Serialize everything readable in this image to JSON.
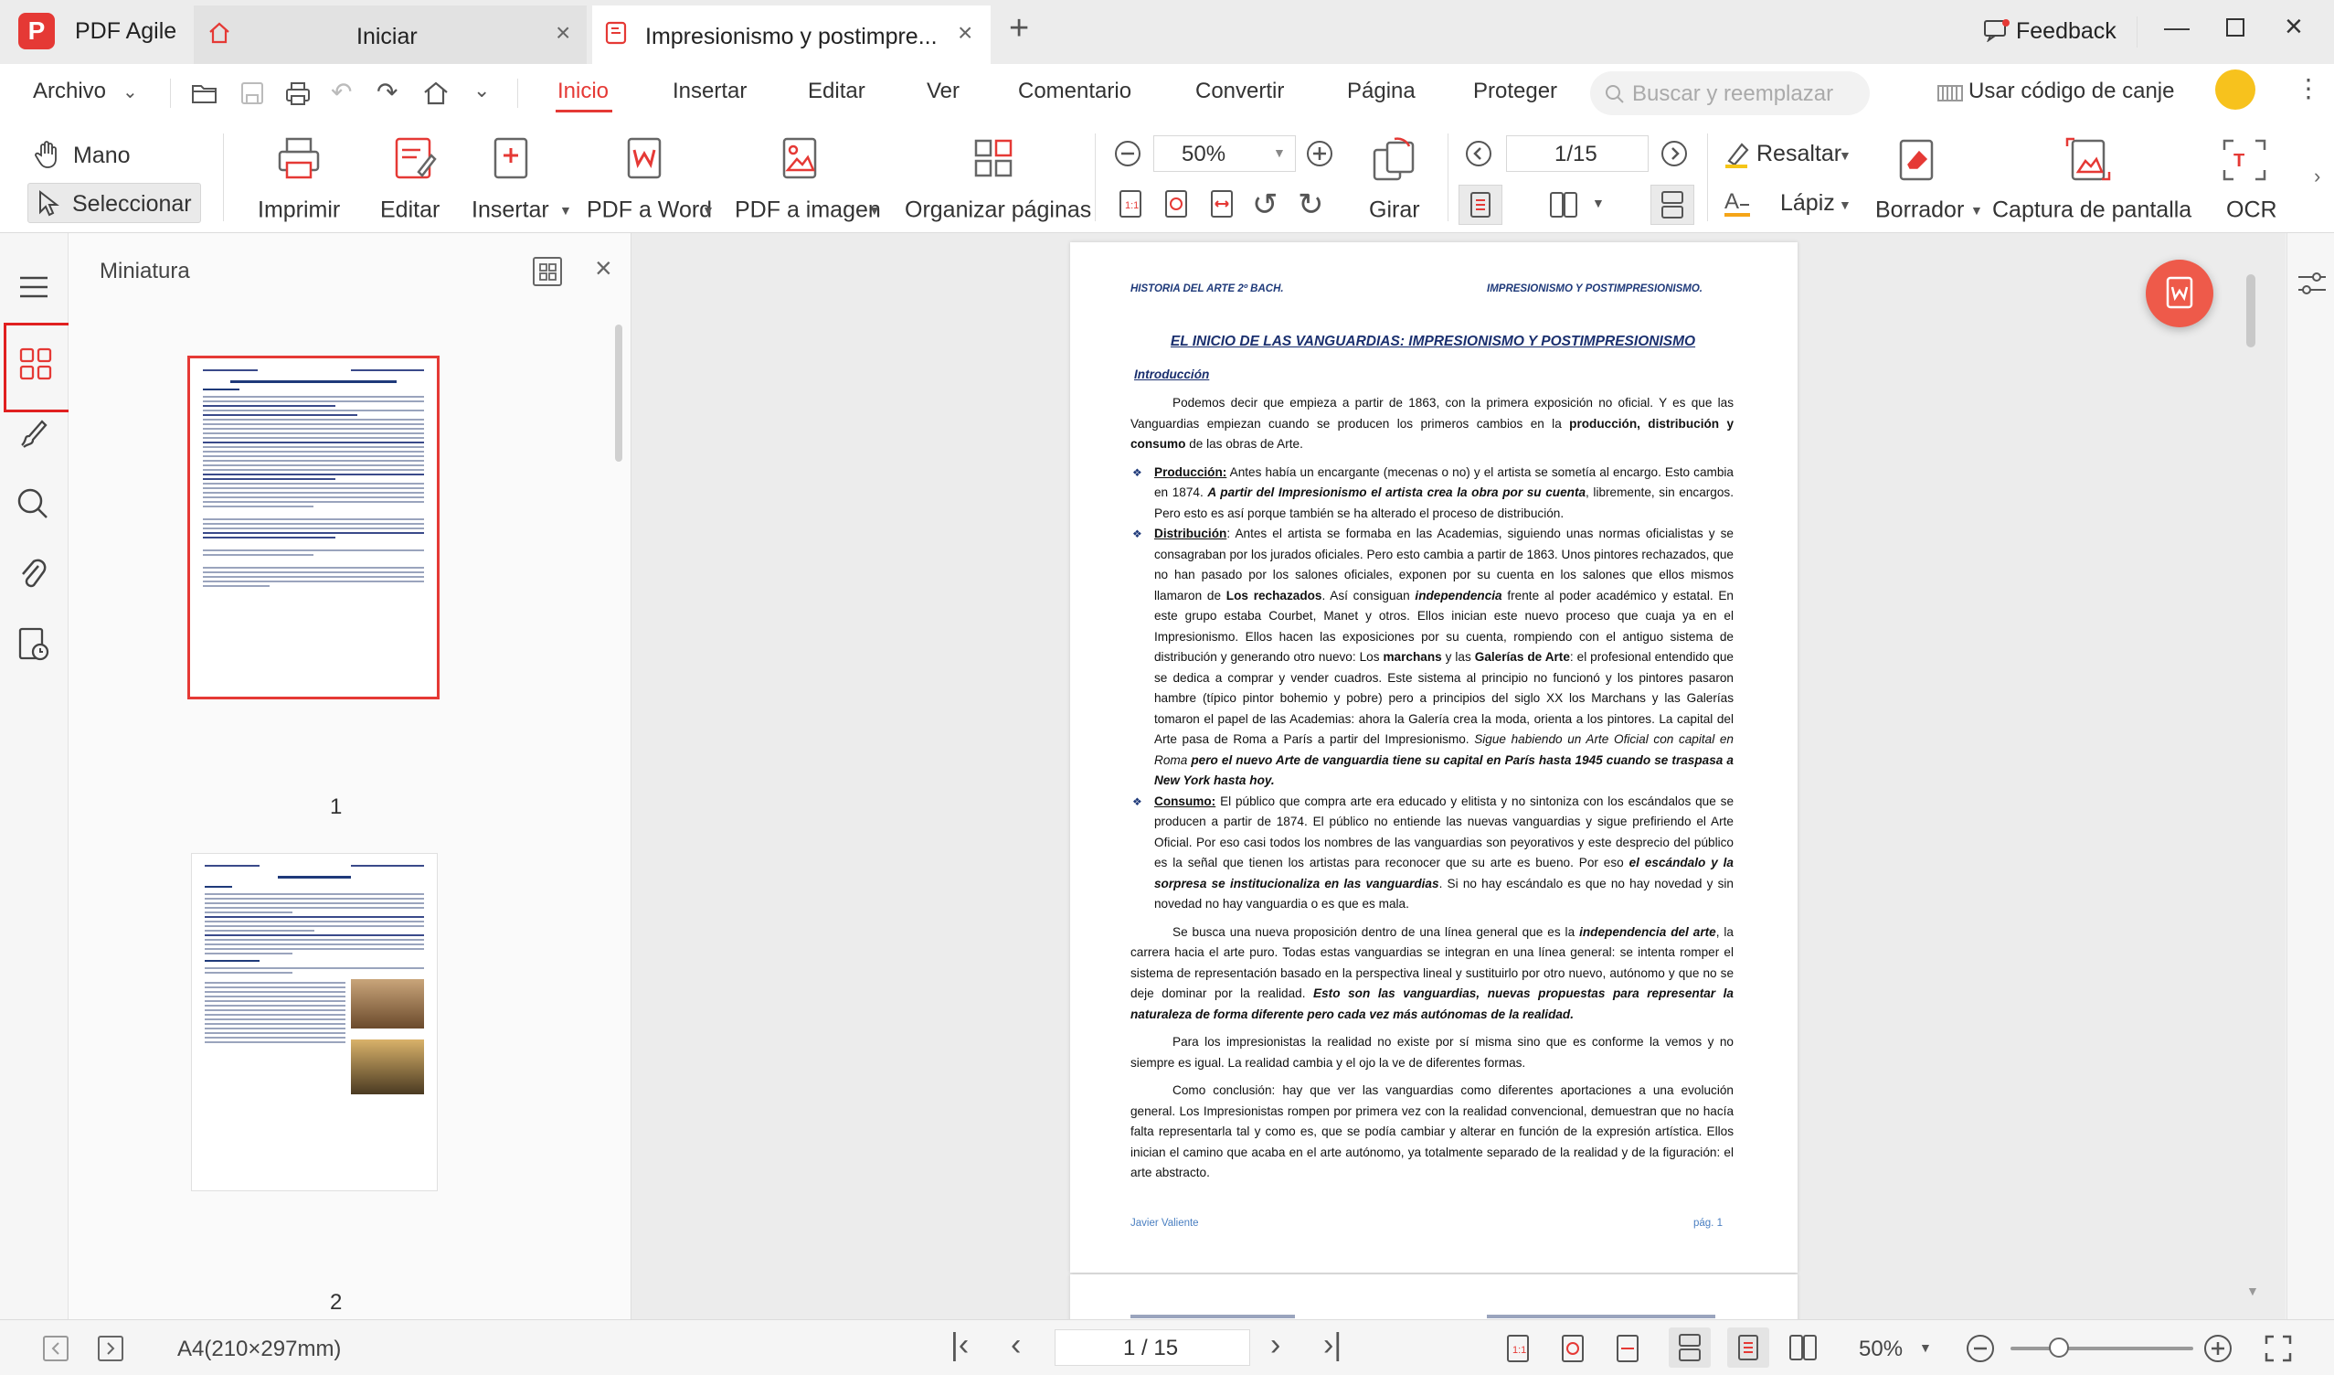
{
  "app": {
    "name": "PDF Agile",
    "logo_letter": "P",
    "brand_color": "#e53935"
  },
  "tabs": [
    {
      "label": "Iniciar",
      "icon": "home-icon"
    },
    {
      "label": "Impresionismo y postimpre...",
      "icon": "pdf-file-icon"
    }
  ],
  "titlebar": {
    "feedback": "Feedback"
  },
  "menu": {
    "archivo": "Archivo",
    "items": [
      "Inicio",
      "Insertar",
      "Editar",
      "Ver",
      "Comentario",
      "Convertir",
      "Página",
      "Proteger"
    ],
    "active": "Inicio",
    "search_placeholder": "Buscar y reemplazar",
    "redeem": "Usar código de canje"
  },
  "ribbon": {
    "mano": "Mano",
    "seleccionar": "Seleccionar",
    "imprimir": "Imprimir",
    "editar": "Editar",
    "insertar": "Insertar",
    "pdf_word": "PDF a Word",
    "pdf_imagen": "PDF a imagen",
    "organizar": "Organizar páginas",
    "zoom": "50%",
    "girar": "Girar",
    "page_indicator": "1/15",
    "resaltar": "Resaltar",
    "lapiz": "Lápiz",
    "borrador": "Borrador",
    "captura": "Captura de pantalla",
    "ocr": "OCR"
  },
  "thumbnails": {
    "title": "Miniatura",
    "pages": [
      "1",
      "2"
    ]
  },
  "document": {
    "header_left": "HISTORIA DEL ARTE 2º BACH.",
    "header_right": "IMPRESIONISMO Y POSTIMPRESIONISMO.",
    "title": "EL INICIO DE LAS VANGUARDIAS: IMPRESIONISMO Y POSTIMPRESIONISMO",
    "intro_heading": "Introducción",
    "intro": {
      "a": "Podemos decir que empieza a partir de 1863, con la primera exposición no oficial.  Y es que las Vanguardias empiezan cuando se producen los primeros cambios en la ",
      "b": "producción, distribución y consumo",
      "c": " de las obras de Arte."
    },
    "produccion": {
      "label": "Producción:",
      "a": " Antes había un encargante (mecenas o no) y el artista se sometía al encargo. Esto cambia en 1874. ",
      "b": "A partir del Impresionismo el artista crea la obra por su cuenta",
      "c": ", libremente, sin encargos. Pero esto es así porque también se ha alterado el proceso de distribución."
    },
    "distribucion": {
      "label": "Distribución",
      "a": ": Antes el artista se formaba en las Academias, siguiendo unas normas oficialistas y se consagraban por los jurados oficiales.  Pero esto cambia a partir de 1863.  Unos pintores rechazados, que no han pasado por los salones oficiales, exponen por su cuenta en los salones que ellos mismos llamaron de ",
      "b": "Los rechazados",
      "c": ". Así consiguan ",
      "d": "independencia",
      "e": " frente al poder académico y estatal.  En este grupo estaba Courbet, Manet y otros.  Ellos inician este nuevo proceso que cuaja ya en el Impresionismo. Ellos hacen las exposiciones por su cuenta, rompiendo con el antiguo sistema de distribución y generando otro nuevo: Los ",
      "f": "marchans",
      "g": " y las ",
      "h": "Galerías de Arte",
      "i": ": el profesional entendido que se dedica a comprar y vender cuadros. Este sistema al principio no funcionó y los pintores pasaron hambre (típico pintor bohemio y pobre) pero a principios del siglo XX los Marchans y las Galerías tomaron el papel de las Academias: ahora la Galería crea la moda, orienta a los pintores. La capital del Arte pasa de Roma a París a partir del Impresionismo. ",
      "j": "Sigue habiendo un Arte Oficial con capital en Roma ",
      "k": "pero el nuevo Arte de vanguardia tiene su capital en París hasta 1945 cuando se traspasa a New York hasta hoy."
    },
    "consumo": {
      "label": "Consumo:",
      "a": " El público que compra arte era educado y elitista y no sintoniza con los escándalos que se producen a partir de 1874.  El público no entiende las nuevas vanguardias y sigue prefiriendo el Arte Oficial.  Por eso casi todos los nombres de las vanguardias son peyorativos y este desprecio del público es la señal que tienen los artistas para reconocer que su arte es bueno. Por eso ",
      "b": "el escándalo y la sorpresa se institucionaliza en las vanguardias",
      "c": ".  Si no hay escándalo es que no hay novedad y sin novedad no hay vanguardia o es que es mala."
    },
    "p2": {
      "a": "Se busca una nueva proposición dentro de una línea general que es la ",
      "b": "independencia del arte",
      "c": ", la carrera hacia el arte puro. Todas estas vanguardias se integran en una línea general: se intenta romper el sistema de representación basado en la perspectiva lineal y sustituirlo por otro nuevo, autónomo y que no se deje dominar por la realidad. ",
      "d": "Esto son las vanguardias, nuevas propuestas para representar la naturaleza de forma diferente pero cada vez más autónomas de la realidad."
    },
    "p3": "Para los impresionistas la realidad no existe por sí misma sino que es conforme la vemos y no siempre es igual.  La realidad cambia y el ojo la ve de diferentes formas.",
    "p4": "Como conclusión: hay que ver las vanguardias como diferentes aportaciones a una evolución general.  Los Impresionistas rompen por primera vez con la realidad convencional, demuestran que no hacía falta representarla tal y como es, que se podía cambiar y alterar en función de la expresión artística.  Ellos inician el camino que acaba en el arte autónomo, ya totalmente separado de la realidad y de la figuración: el arte abstracto.",
    "footer_left": "Javier Valiente",
    "footer_right": "pág. 1"
  },
  "statusbar": {
    "page_size": "A4(210×297mm)",
    "page_indicator": "1 / 15",
    "zoom": "50%"
  }
}
